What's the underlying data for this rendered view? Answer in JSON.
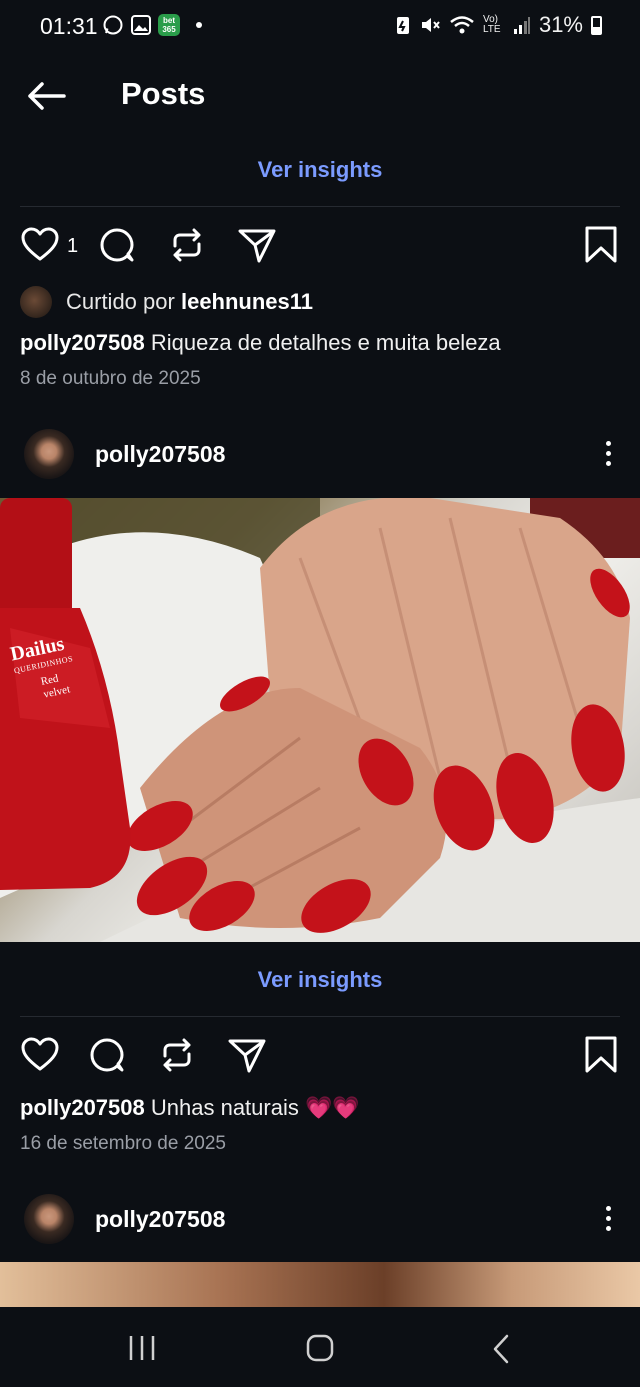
{
  "status_bar": {
    "time": "01:31",
    "bet_icon_text": "bet 365",
    "volte_text": "Vo) LTE",
    "battery": "31%"
  },
  "header": {
    "title": "Posts",
    "back_icon": "arrow-left-icon"
  },
  "post1": {
    "insights_label": "Ver insights",
    "like_count": "1",
    "liked_by_prefix": "Curtido por",
    "liked_by_user": "leehnunes11",
    "caption_user": "polly207508",
    "caption_text": "Riqueza de detalhes e muita beleza",
    "date": "8 de outubro de 2025"
  },
  "post2": {
    "username": "polly207508",
    "photo_text": {
      "brand": "Dailus",
      "line": "QUERIDINHOS",
      "shade": "Red velvet"
    },
    "insights_label": "Ver insights",
    "caption_user": "polly207508",
    "caption_text": "Unhas naturais 💗💗",
    "date": "16 de setembro de 2025"
  },
  "post3": {
    "username": "polly207508"
  },
  "colors": {
    "background": "#0c0f14",
    "accent_link": "#7b9bff",
    "nail_red": "#c4121a"
  },
  "icons": [
    "heart-icon",
    "comment-icon",
    "repost-icon",
    "send-icon",
    "bookmark-icon",
    "more-vertical-icon",
    "recents-icon",
    "home-icon",
    "back-nav-icon"
  ]
}
